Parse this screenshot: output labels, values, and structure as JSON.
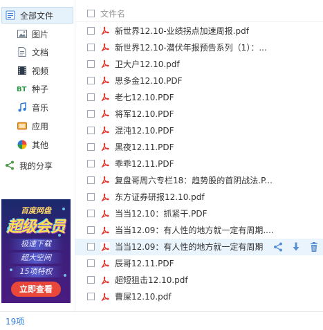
{
  "sidebar": {
    "items": [
      {
        "label": "全部文件",
        "icon": "all-files-icon",
        "active": true
      },
      {
        "label": "图片",
        "icon": "image-icon"
      },
      {
        "label": "文档",
        "icon": "document-icon"
      },
      {
        "label": "视频",
        "icon": "video-icon"
      },
      {
        "label": "种子",
        "icon": "bt-icon"
      },
      {
        "label": "音乐",
        "icon": "music-icon"
      },
      {
        "label": "应用",
        "icon": "app-icon"
      },
      {
        "label": "其他",
        "icon": "other-icon"
      }
    ],
    "share": {
      "label": "我的分享",
      "icon": "share-icon"
    }
  },
  "promo": {
    "brand": "百度网盘",
    "title": "超级会员",
    "features": [
      "极速下载",
      "超大空间",
      "15项特权"
    ],
    "button": "立即查看"
  },
  "list": {
    "header": "文件名",
    "files": [
      "新世界12.10-业绩拐点加速周报.pdf",
      "新世界12.10-潜伏年报预告系列（1）：...",
      "卫大户12.10.pdf",
      "思多金12.10.PDF",
      "老七12.10.PDF",
      "将军12.10.PDF",
      "混沌12.10.PDF",
      "黑夜12.11.PDF",
      "乖乖12.11.PDF",
      "复盘哥周六专栏18：趋势股的首阴战法.P...",
      "东方证券研报12.10.pdf",
      "当当12.10：抓紧干.PDF",
      "当当12.09：有人性的地方就一定有周期....",
      "当当12.09：有人性的地方就一定有周期",
      "辰哥12.11.PDF",
      "超短狙击12.10.pdf",
      "曹屎12.10.pdf"
    ],
    "hover_index": 13,
    "row_actions": [
      "share-icon",
      "download-icon",
      "delete-icon"
    ]
  },
  "footer": {
    "count": "19项"
  },
  "colors": {
    "accent": "#2e7ad6",
    "pdf": "#e0342b",
    "promo_button": "#e8473a",
    "hover_row": "#eaf4fd"
  }
}
